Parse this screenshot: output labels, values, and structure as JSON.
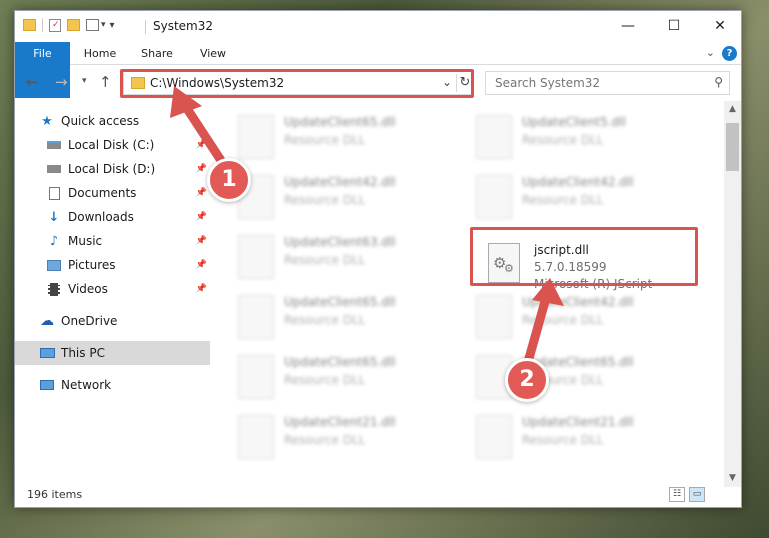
{
  "window": {
    "title": "System32",
    "controls": {
      "minimize": "—",
      "maximize": "☐",
      "close": "✕"
    }
  },
  "ribbon": {
    "tabs": [
      "File",
      "Home",
      "Share",
      "View"
    ],
    "help": "?"
  },
  "nav": {
    "address": "C:\\Windows\\System32",
    "search_placeholder": "Search System32"
  },
  "sidebar": {
    "items": [
      {
        "label": "Quick access",
        "icon": "star-icon",
        "pinned": false
      },
      {
        "label": "Local Disk (C:)",
        "icon": "drive-icon",
        "pinned": true
      },
      {
        "label": "Local Disk (D:)",
        "icon": "drive-icon",
        "pinned": true
      },
      {
        "label": "Documents",
        "icon": "documents-icon",
        "pinned": true
      },
      {
        "label": "Downloads",
        "icon": "download-icon",
        "pinned": true
      },
      {
        "label": "Music",
        "icon": "music-icon",
        "pinned": true
      },
      {
        "label": "Pictures",
        "icon": "pictures-icon",
        "pinned": true
      },
      {
        "label": "Videos",
        "icon": "videos-icon",
        "pinned": true
      },
      {
        "label": "OneDrive",
        "icon": "cloud-icon",
        "pinned": false
      },
      {
        "label": "This PC",
        "icon": "computer-icon",
        "pinned": false,
        "selected": true
      },
      {
        "label": "Network",
        "icon": "network-icon",
        "pinned": false
      }
    ]
  },
  "files": {
    "left": [
      {
        "name": "UpdateClient65.dll",
        "type": "Resource DLL"
      },
      {
        "name": "UpdateClient42.dll",
        "type": "Resource DLL"
      },
      {
        "name": "UpdateClient63.dll",
        "type": "Resource DLL"
      },
      {
        "name": "UpdateClient65.dll",
        "type": "Resource DLL"
      },
      {
        "name": "UpdateClient65.dll",
        "type": "Resource DLL"
      },
      {
        "name": "UpdateClient21.dll",
        "type": "Resource DLL"
      }
    ],
    "right": [
      {
        "name": "UpdateClient5.dll",
        "type": "Resource DLL"
      },
      {
        "name": "UpdateClient42.dll",
        "type": "Resource DLL"
      },
      {
        "name": "UpdateClient42.dll",
        "type": "Resource DLL"
      },
      {
        "name": "UpdateClient65.dll",
        "type": "Resource DLL"
      },
      {
        "name": "UpdateClient21.dll",
        "type": "Resource DLL"
      }
    ],
    "highlighted": {
      "name": "jscript.dll",
      "version": "5.7.0.18599",
      "description": "Microsoft (R) JScript"
    }
  },
  "status": {
    "item_count": "196 items"
  },
  "annotations": {
    "step1": "1",
    "step2": "2",
    "color": "#d9534f"
  }
}
